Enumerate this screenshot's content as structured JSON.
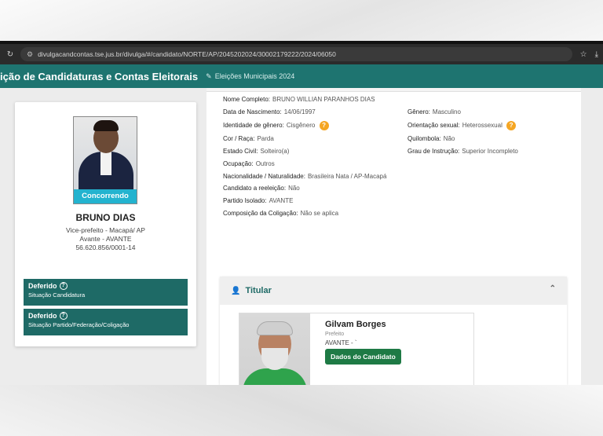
{
  "browser": {
    "url": "divulgacandcontas.tse.jus.br/divulga/#/candidato/NORTE/AP/2045202024/30002179222/2024/06050",
    "reload_icon": "reload-icon",
    "bookmark_icon": "star-icon",
    "download_icon": "download-icon"
  },
  "header": {
    "title": "ição de Candidaturas e Contas Eleitorais",
    "election": "Eleições Municipais 2024"
  },
  "candidate": {
    "status_ribbon": "Concorrendo",
    "name": "BRUNO DIAS",
    "position": "Vice-prefeito - Macapá/ AP",
    "party": "Avante - AVANTE",
    "cnpj": "56.620.856/0001-14",
    "statuses": [
      {
        "title": "Deferido",
        "subtitle": "Situação Candidatura"
      },
      {
        "title": "Deferido",
        "subtitle": "Situação Partido/Federação/Coligação"
      }
    ]
  },
  "details": {
    "nome_completo": {
      "label": "Nome Completo:",
      "value": "BRUNO WILLIAN PARANHOS DIAS"
    },
    "nascimento": {
      "label": "Data de Nascimento:",
      "value": "14/06/1997"
    },
    "genero": {
      "label": "Gênero:",
      "value": "Masculino"
    },
    "identidade": {
      "label": "Identidade de gênero:",
      "value": "Cisgênero"
    },
    "orientacao": {
      "label": "Orientação sexual:",
      "value": "Heterossexual"
    },
    "cor": {
      "label": "Cor / Raça:",
      "value": "Parda"
    },
    "quilombola": {
      "label": "Quilombola:",
      "value": "Não"
    },
    "estado_civil": {
      "label": "Estado Civil:",
      "value": "Solteiro(a)"
    },
    "instrucao": {
      "label": "Grau de Instrução:",
      "value": "Superior Incompleto"
    },
    "ocupacao": {
      "label": "Ocupação:",
      "value": "Outros"
    },
    "nacionalidade": {
      "label": "Nacionalidade / Naturalidade:",
      "value": "Brasileira Nata / AP-Macapá"
    },
    "reeleicao": {
      "label": "Candidato a reeleição:",
      "value": "Não"
    },
    "partido": {
      "label": "Partido Isolado:",
      "value": "AVANTE"
    },
    "coligacao": {
      "label": "Composição da Coligação:",
      "value": "Não se aplica"
    }
  },
  "titular": {
    "section_title": "Titular",
    "name": "Gilvam Borges",
    "role": "Prefeito",
    "party": "AVANTE - `",
    "button": "Dados do Candidato"
  }
}
